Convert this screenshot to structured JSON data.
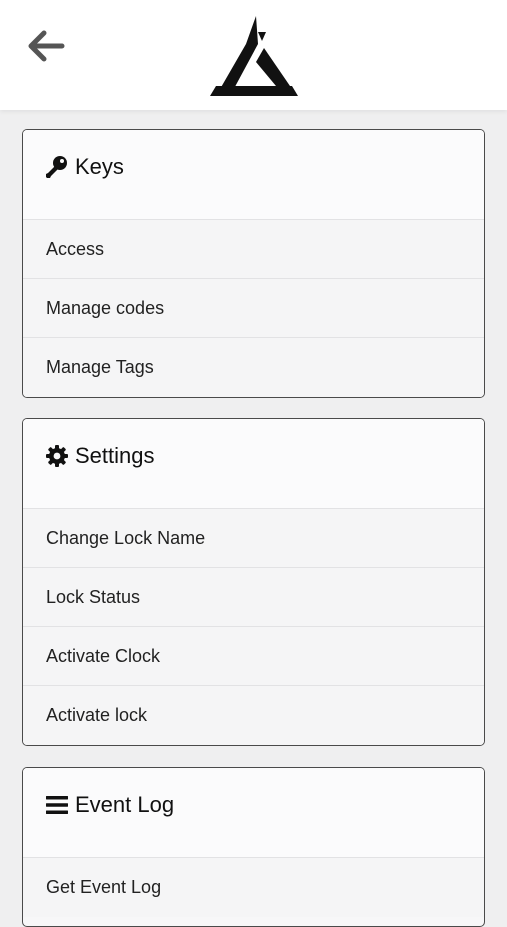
{
  "header": {
    "back_icon": "arrow-left-icon",
    "logo": "brand-triangle-logo"
  },
  "sections": [
    {
      "title": "Keys",
      "icon": "key-icon",
      "items": [
        "Access",
        "Manage codes",
        "Manage Tags"
      ]
    },
    {
      "title": "Settings",
      "icon": "gear-icon",
      "items": [
        "Change Lock Name",
        "Lock Status",
        "Activate Clock",
        "Activate lock"
      ]
    },
    {
      "title": "Event Log",
      "icon": "list-icon",
      "items": [
        "Get Event Log"
      ]
    }
  ],
  "colors": {
    "background": "#efeff0",
    "card_border": "#4a4a4a",
    "icon": "#111111",
    "back_arrow": "#555555"
  }
}
